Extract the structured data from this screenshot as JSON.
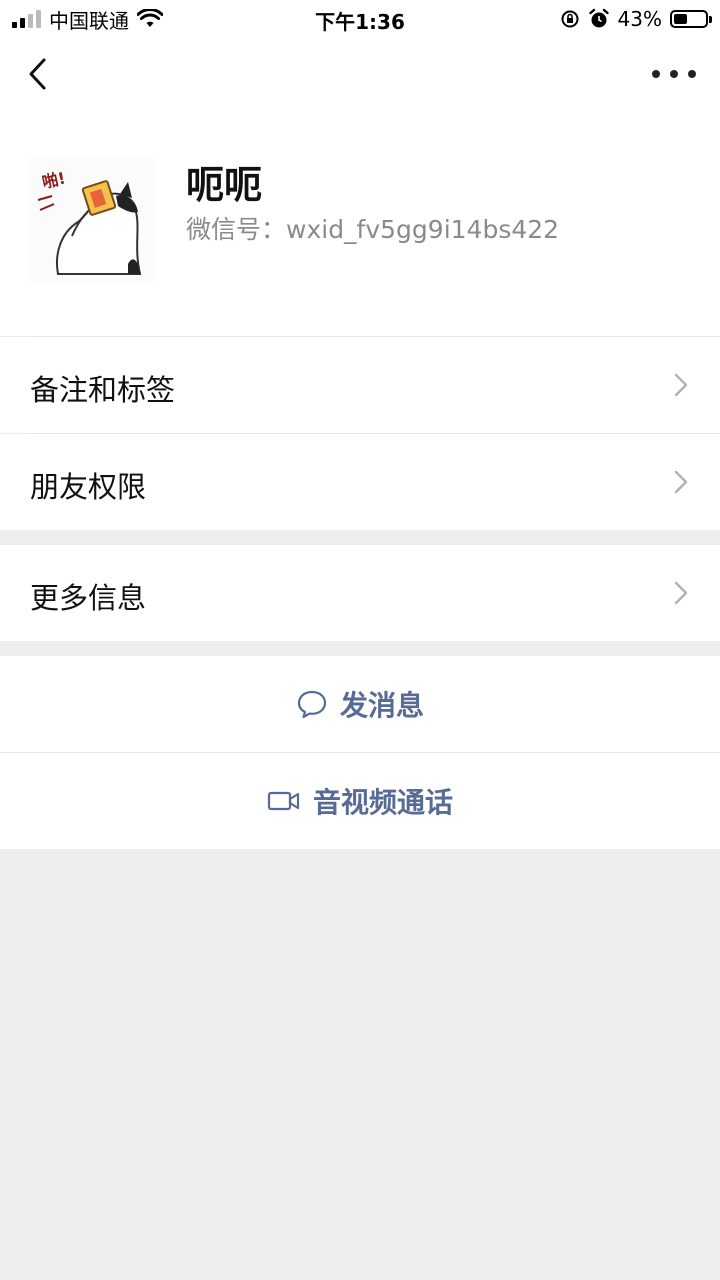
{
  "status_bar": {
    "carrier": "中国联通",
    "time": "下午1:36",
    "battery_pct": "43%",
    "battery_level": 0.43,
    "icons": [
      "signal-icon",
      "wifi-icon",
      "orientation-lock-icon",
      "alarm-icon",
      "battery-icon"
    ]
  },
  "nav": {
    "back_icon": "chevron-left-icon",
    "more_icon": "more-dots-icon"
  },
  "profile": {
    "nickname": "呃呃",
    "wxid": "微信号：wxid_fv5gg9i14bs422"
  },
  "menu": {
    "remark_tags": "备注和标签",
    "friend_permissions": "朋友权限",
    "more_info": "更多信息"
  },
  "actions": {
    "send_message": "发消息",
    "av_call": "音视频通话"
  },
  "colors": {
    "link_blue": "#576b95",
    "background": "#ededed",
    "divider": "#e6e6e6"
  }
}
